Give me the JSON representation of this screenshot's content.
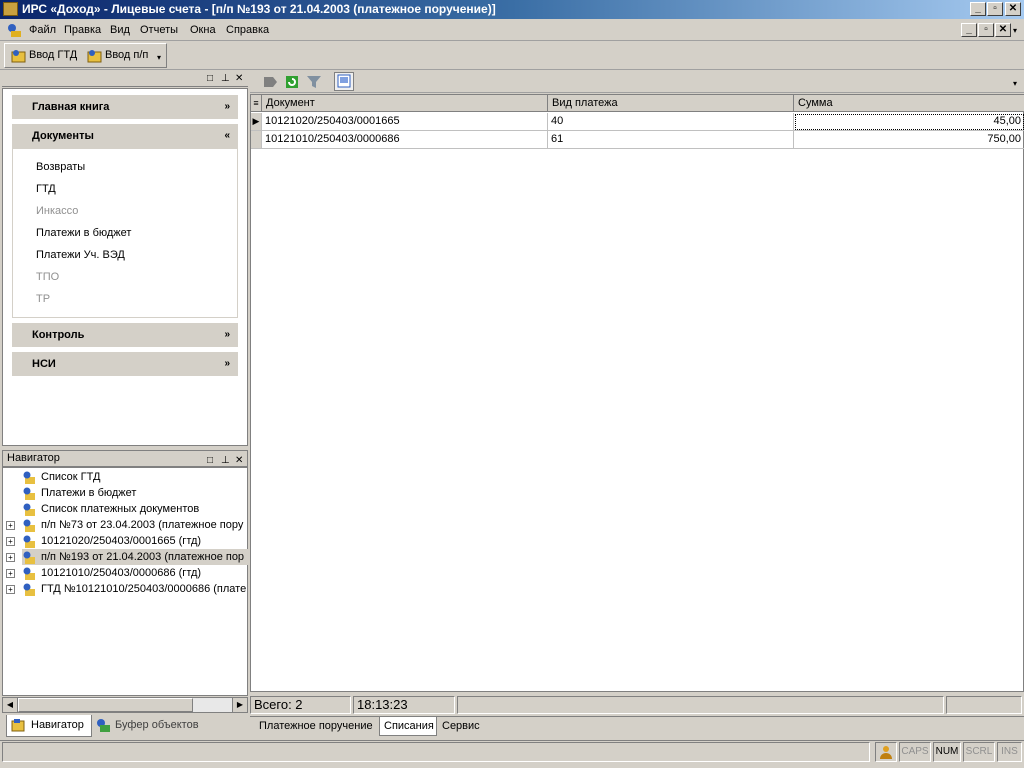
{
  "window": {
    "title": "ИРС «Доход» - Лицевые счета - [п/п №193 от 21.04.2003 (платежное поручение)]"
  },
  "menu": [
    "Файл",
    "Правка",
    "Вид",
    "Отчеты",
    "Окна",
    "Справка"
  ],
  "toolbar": {
    "btn1": "Ввод ГТД",
    "btn2": "Ввод п/п"
  },
  "left_panel": {
    "categories": [
      {
        "label": "Главная книга"
      },
      {
        "label": "Документы"
      },
      {
        "label": "Контроль"
      },
      {
        "label": "НСИ"
      }
    ],
    "documents": [
      {
        "label": "Возвраты",
        "enabled": true
      },
      {
        "label": "ГТД",
        "enabled": true
      },
      {
        "label": "Инкассо",
        "enabled": false
      },
      {
        "label": "Платежи в бюджет",
        "enabled": true
      },
      {
        "label": "Платежи Уч. ВЭД",
        "enabled": true
      },
      {
        "label": "ТПО",
        "enabled": false
      },
      {
        "label": "ТР",
        "enabled": false
      }
    ]
  },
  "navigator": {
    "title": "Навигатор",
    "items": [
      {
        "label": "Список ГТД",
        "expandable": false
      },
      {
        "label": "Платежи в бюджет",
        "expandable": false
      },
      {
        "label": "Список платежных документов",
        "expandable": false
      },
      {
        "label": "п/п №73 от 23.04.2003 (платежное пору",
        "expandable": true
      },
      {
        "label": "10121020/250403/0001665 (гтд)",
        "expandable": true
      },
      {
        "label": "п/п №193 от 21.04.2003 (платежное пор",
        "expandable": true,
        "selected": true
      },
      {
        "label": "10121010/250403/0000686 (гтд)",
        "expandable": true
      },
      {
        "label": "ГТД №10121010/250403/0000686 (плате",
        "expandable": true
      }
    ],
    "tabs": [
      "Навигатор",
      "Буфер объектов"
    ]
  },
  "grid": {
    "columns": [
      "Документ",
      "Вид платежа",
      "Сумма"
    ],
    "rows": [
      [
        "10121020/250403/0001665",
        "40",
        "45,00"
      ],
      [
        "10121010/250403/0000686",
        "61",
        "750,00"
      ]
    ]
  },
  "status": {
    "total": "Всего: 2",
    "time": "18:13:23"
  },
  "bottom_tabs": [
    "Платежное поручение",
    "Списания",
    "Сервис"
  ],
  "statusbar": {
    "caps": "CAPS",
    "num": "NUM",
    "scrl": "SCRL",
    "ins": "INS"
  }
}
